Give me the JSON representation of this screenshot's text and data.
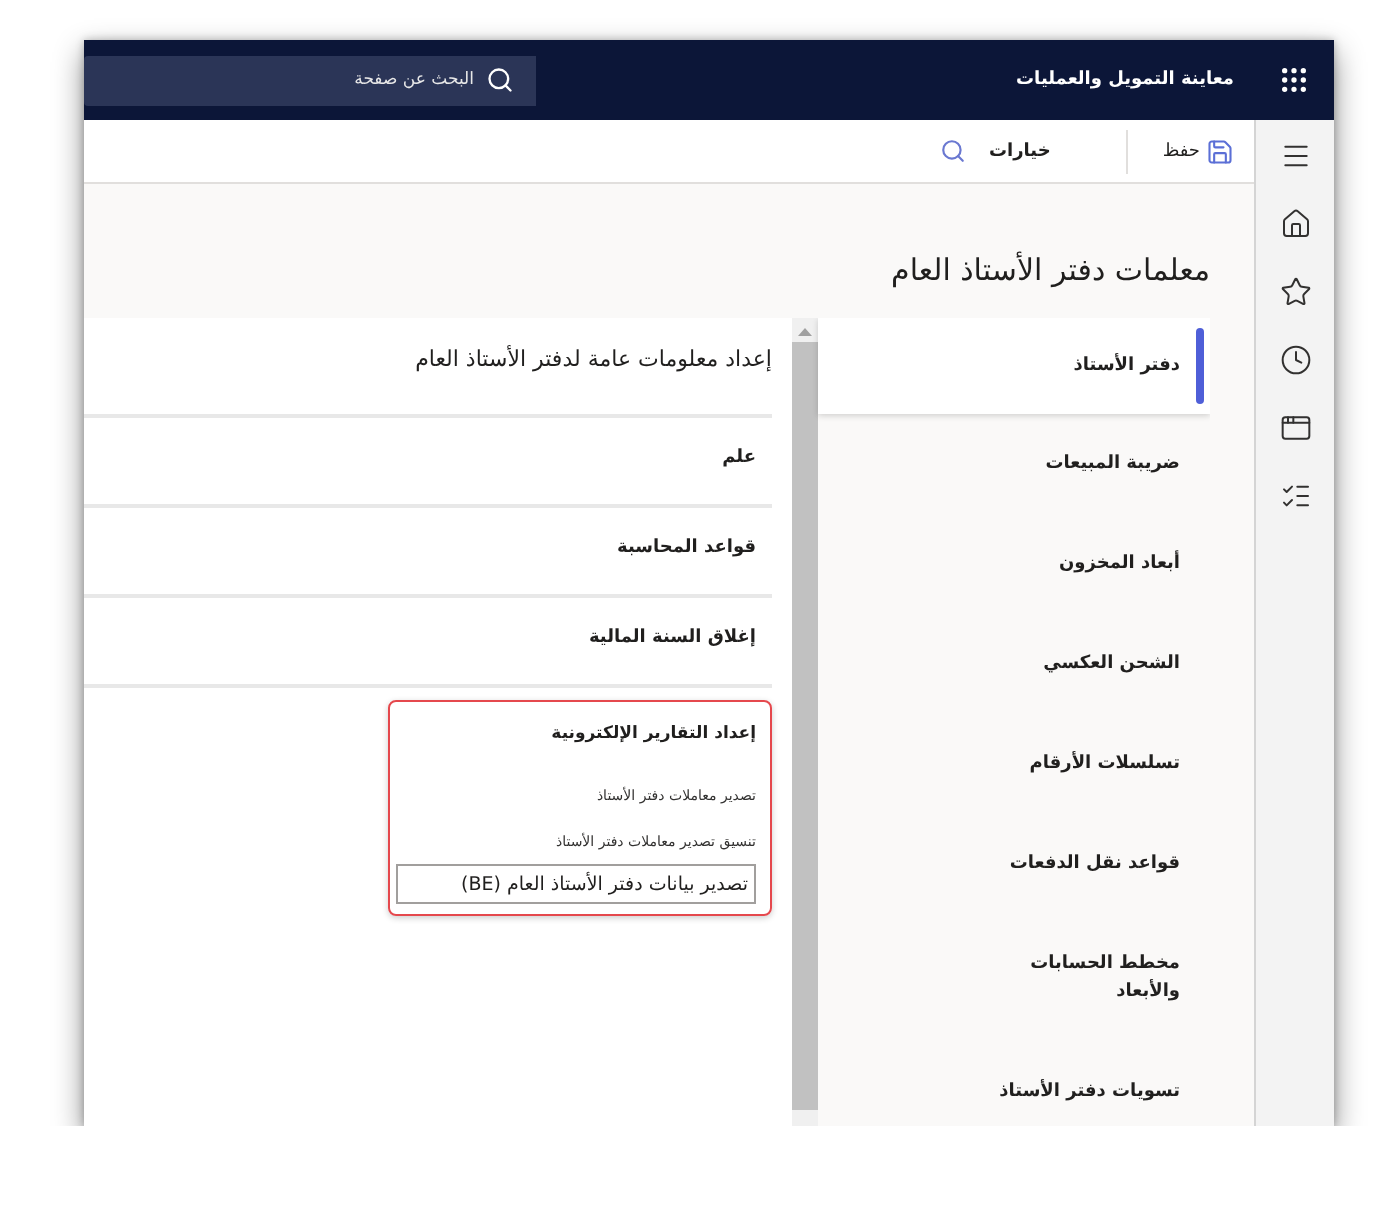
{
  "top_bar": {
    "title": "معاينة التمويل والعمليات",
    "search": {
      "placeholder": "البحث عن صفحة"
    }
  },
  "action_bar": {
    "buttons": [
      {
        "kind": "save",
        "label": "حفظ"
      },
      {
        "kind": "options",
        "label": "خيارات"
      }
    ]
  },
  "page": {
    "title": "معلمات دفتر الأستاذ العام",
    "tabs": [
      {
        "label": "دفتر الأستاذ",
        "selected": true
      },
      {
        "label": "ضريبة المبيعات",
        "selected": false
      },
      {
        "label": "أبعاد المخزون",
        "selected": false
      },
      {
        "label": "الشحن العكسي",
        "selected": false
      },
      {
        "label": "تسلسلات الأرقام",
        "selected": false
      },
      {
        "label": "قواعد نقل الدفعات",
        "selected": false
      },
      {
        "label": "مخطط الحسابات والأبعاد",
        "selected": false
      },
      {
        "label": "تسويات دفتر الأستاذ",
        "selected": false
      }
    ],
    "panel": {
      "heading": "إعداد معلومات عامة لدفتر الأستاذ العام",
      "sections": [
        {
          "title": "علم",
          "highlighted": false
        },
        {
          "title": "قواعد المحاسبة",
          "highlighted": false
        },
        {
          "title": "إغلاق السنة المالية",
          "highlighted": false
        },
        {
          "title": "إعداد التقارير الإلكترونية",
          "highlighted": true,
          "fields": [
            {
              "kind": "label",
              "label": "تصدير معاملات دفتر الأستاذ"
            },
            {
              "kind": "input",
              "label": "تنسيق تصدير معاملات دفتر الأستاذ",
              "value": "تصدير بيانات دفتر الأستاذ العام (BE)"
            }
          ]
        }
      ]
    }
  }
}
